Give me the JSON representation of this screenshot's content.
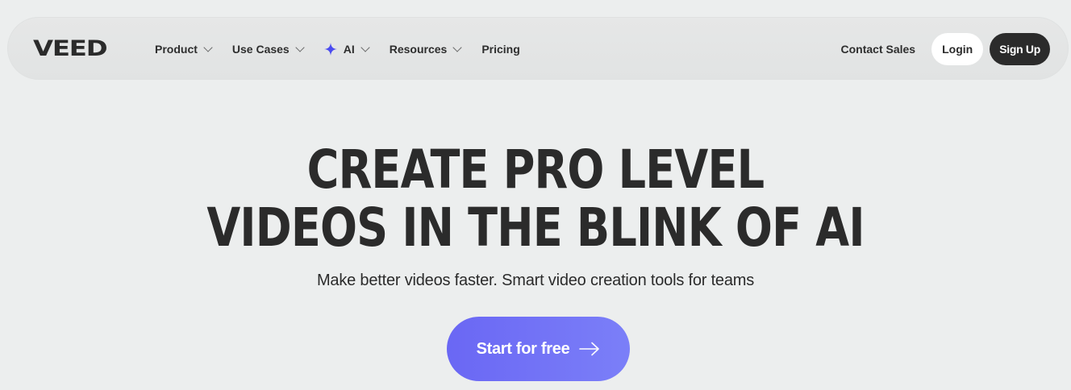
{
  "brand": {
    "logo_text": "VEED"
  },
  "nav": {
    "items": [
      {
        "label": "Product",
        "has_dropdown": true
      },
      {
        "label": "Use Cases",
        "has_dropdown": true
      },
      {
        "label": "AI",
        "has_dropdown": true,
        "icon": "sparkle-icon"
      },
      {
        "label": "Resources",
        "has_dropdown": true
      },
      {
        "label": "Pricing",
        "has_dropdown": false
      }
    ],
    "contact_label": "Contact Sales",
    "login_label": "Login",
    "signup_label": "Sign Up"
  },
  "hero": {
    "headline_line1": "CREATE PRO LEVEL",
    "headline_line2": "VIDEOS IN THE BLINK OF AI",
    "subheadline": "Make better videos faster. Smart video creation tools for teams",
    "cta_label": "Start for free",
    "cta_icon": "arrow-right-icon"
  },
  "colors": {
    "background": "#eceeee",
    "text": "#2b2b2b",
    "accent_start": "#6a67f4",
    "accent_end": "#7b7ff8",
    "sparkle": "#4b4cf0"
  }
}
